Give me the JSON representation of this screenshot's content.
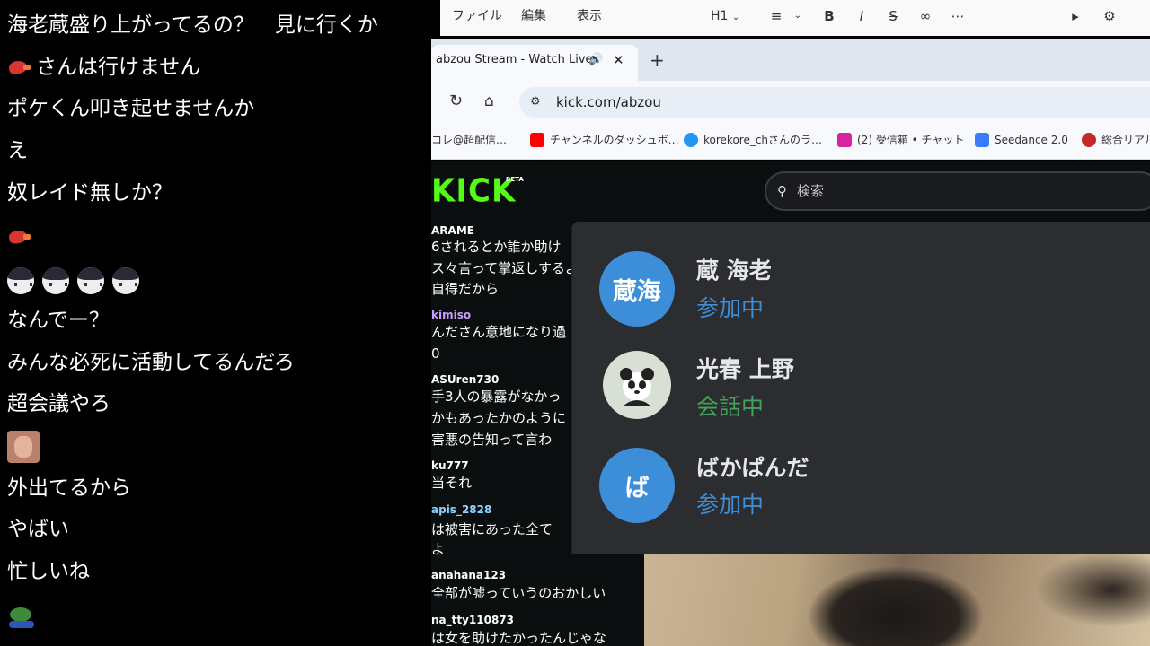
{
  "left_chat": {
    "lines": [
      {
        "text": "海老蔵盛り上がってるの？　見に行くか"
      },
      {
        "emote": "shrimp-emote",
        "text": "さんは行けません"
      },
      {
        "text": "ポケくん叩き起せませんか"
      },
      {
        "text": "え"
      },
      {
        "text": "奴レイド無しか？"
      },
      {
        "emote": "shrimp-emote",
        "text": ""
      },
      {
        "emote": "face-emote",
        "text": ""
      },
      {
        "text": "なんでー？"
      },
      {
        "text": "みんな必死に活動してるんだろ"
      },
      {
        "text": "超会議やろ"
      },
      {
        "emote": "photo-emote",
        "text": ""
      },
      {
        "text": "外出てるから"
      },
      {
        "text": "やばい"
      },
      {
        "text": "忙しいね"
      },
      {
        "emote": "frog-emote",
        "text": ""
      }
    ]
  },
  "app_toolbar": {
    "menu_file": "ファイル",
    "menu_edit": "編集",
    "menu_view": "表示",
    "heading_select": "H1",
    "icons": [
      "list-icon",
      "bold-icon",
      "italic-icon",
      "strikethrough-icon",
      "link-icon",
      "more-icon",
      "megaphone-icon",
      "settings-icon"
    ]
  },
  "browser": {
    "tab_title": "abzou Stream - Watch Live",
    "url": "kick.com/abzou",
    "bookmarks": [
      {
        "label": "コレ@超配信…",
        "color": "#f2f2f2"
      },
      {
        "label": "チャンネルのダッシュボ…",
        "color": "#ff0000"
      },
      {
        "label": "korekore_chさんのラ…",
        "color": "#2196f3"
      },
      {
        "label": "(2) 受信箱 • チャット",
        "color": "#d6249f"
      },
      {
        "label": "Seedance 2.0",
        "color": "#3a7bfd"
      },
      {
        "label": "総合リアル",
        "color": "#c62828"
      }
    ]
  },
  "kick": {
    "logo": "KICK",
    "beta": "BETA",
    "search_placeholder": "検索",
    "chat": [
      {
        "type": "user",
        "text": "ARAME",
        "color": "#ffffff"
      },
      {
        "type": "msg",
        "text": "6されるとか誰か助け"
      },
      {
        "type": "msg",
        "text": "ス々言って掌返しするよ"
      },
      {
        "type": "msg",
        "text": "自得だから"
      },
      {
        "type": "user",
        "text": "kimiso",
        "color": "#c7a0ff"
      },
      {
        "type": "msg",
        "text": "んださん意地になり過"
      },
      {
        "type": "msg",
        "text": "0"
      },
      {
        "type": "user",
        "text": "ASUren730",
        "color": "#ffffff"
      },
      {
        "type": "msg",
        "text": "手3人の暴露がなかっ"
      },
      {
        "type": "msg",
        "text": "かもあったかのように"
      },
      {
        "type": "msg",
        "text": "害悪の告知って言わ"
      },
      {
        "type": "user",
        "text": "ku777",
        "color": "#ffffff"
      },
      {
        "type": "msg",
        "text": "当それ"
      },
      {
        "type": "user",
        "text": "apis_2828",
        "color": "#8fd3ff"
      },
      {
        "type": "msg",
        "text": "は被害にあった全て"
      },
      {
        "type": "msg",
        "text": "よ"
      },
      {
        "type": "user",
        "text": "anahana123",
        "color": "#ffffff"
      },
      {
        "type": "msg",
        "text": "全部が嘘っていうのおかしい"
      },
      {
        "type": "user",
        "text": "na_tty110873",
        "color": "#ffffff"
      },
      {
        "type": "msg",
        "text": "は女を助けたかったんじゃな"
      }
    ]
  },
  "voice_panel": {
    "members": [
      {
        "avatar_text": "蔵海",
        "name": "蔵 海老",
        "status": "参加中",
        "status_color": "#3d8ed9"
      },
      {
        "avatar_text": "",
        "name": "光春 上野",
        "status": "会話中",
        "status_color": "#43a25a"
      },
      {
        "avatar_text": "ば",
        "name": "ばかぱんだ",
        "status": "参加中",
        "status_color": "#3d8ed9"
      }
    ]
  }
}
